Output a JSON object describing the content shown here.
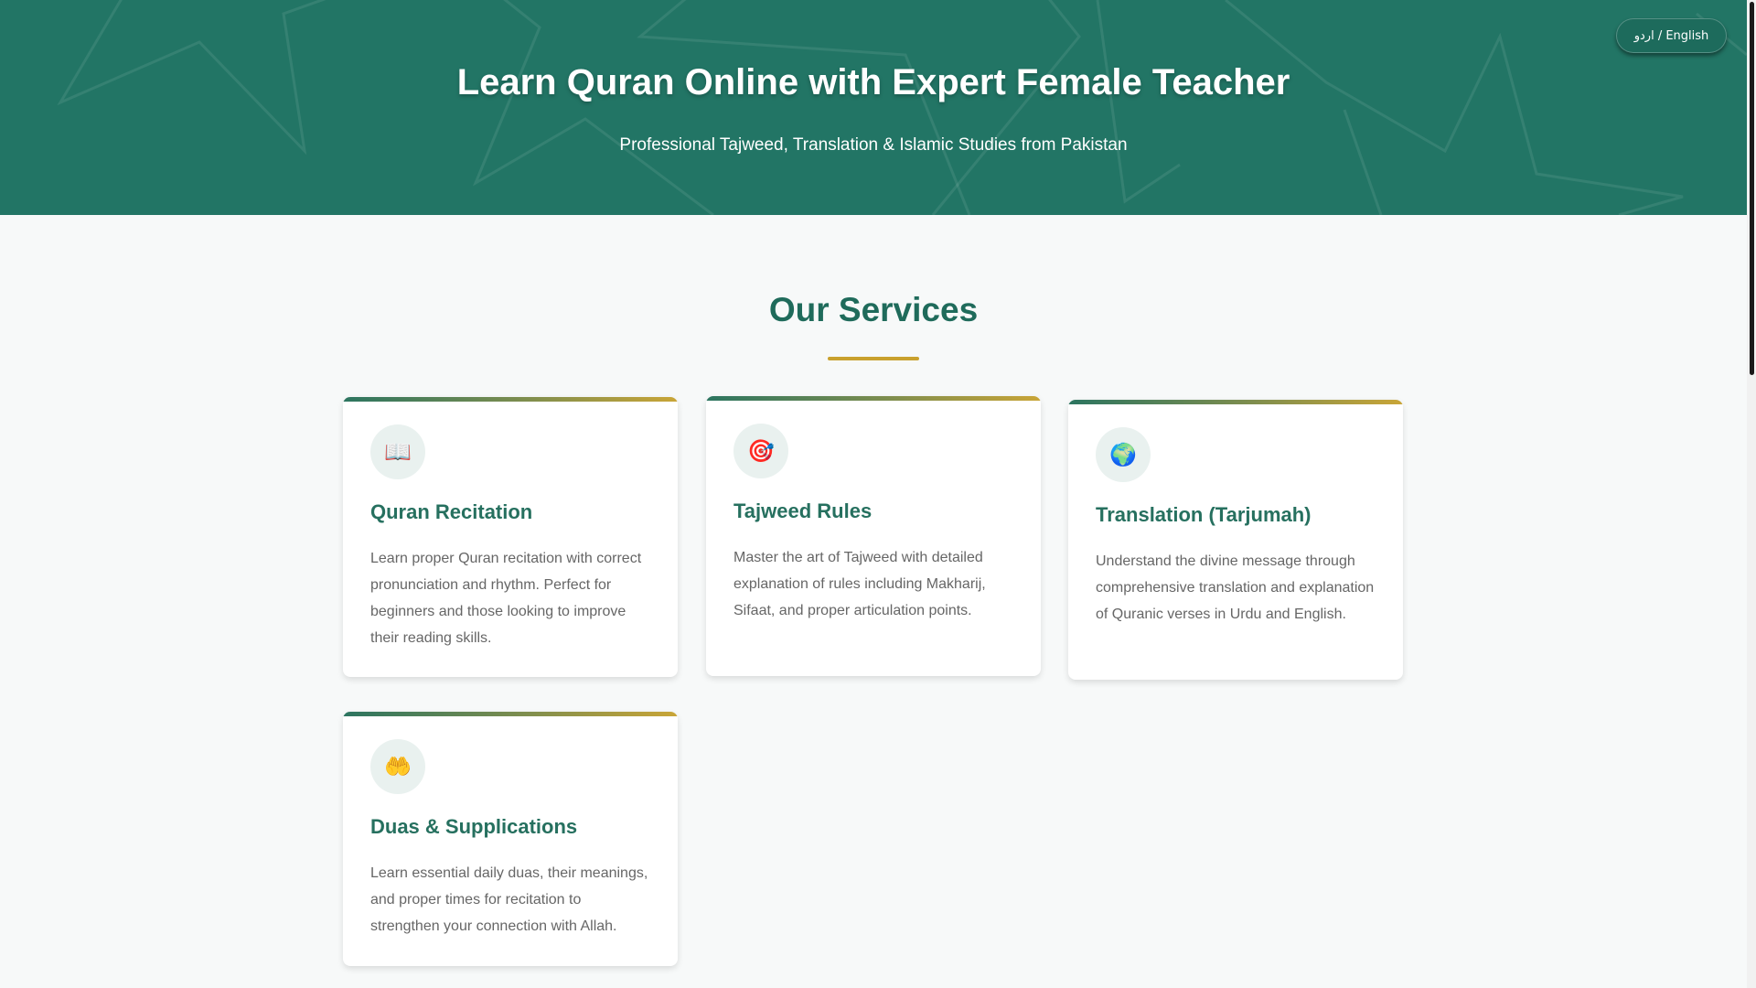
{
  "hero": {
    "title": "Learn Quran Online with Expert Female Teacher",
    "subtitle": "Professional Tajweed, Translation & Islamic Studies from Pakistan"
  },
  "language_toggle": {
    "label": "اردو / English"
  },
  "services": {
    "title": "Our Services",
    "cards": [
      {
        "icon": "📖",
        "icon_name": "open-book-icon",
        "title": "Quran Recitation",
        "description": "Learn proper Quran recitation with correct pronunciation and rhythm. Perfect for beginners and those looking to improve their reading skills."
      },
      {
        "icon": "🎯",
        "icon_name": "target-icon",
        "title": "Tajweed Rules",
        "description": "Master the art of Tajweed with detailed explanation of rules including Makharij, Sifaat, and proper articulation points."
      },
      {
        "icon": "🌍",
        "icon_name": "globe-icon",
        "title": "Translation (Tarjumah)",
        "description": "Understand the divine message through comprehensive translation and explanation of Quranic verses in Urdu and English."
      },
      {
        "icon": "🤲",
        "icon_name": "praying-hands-icon",
        "title": "Duas & Supplications",
        "description": "Learn essential daily duas, their meanings, and proper times for recitation to strengthen your connection with Allah."
      }
    ]
  },
  "colors": {
    "hero_bg": "#227565",
    "accent_green": "#1f6b5b",
    "accent_gold": "#c9a12e",
    "card_text": "#666666"
  }
}
